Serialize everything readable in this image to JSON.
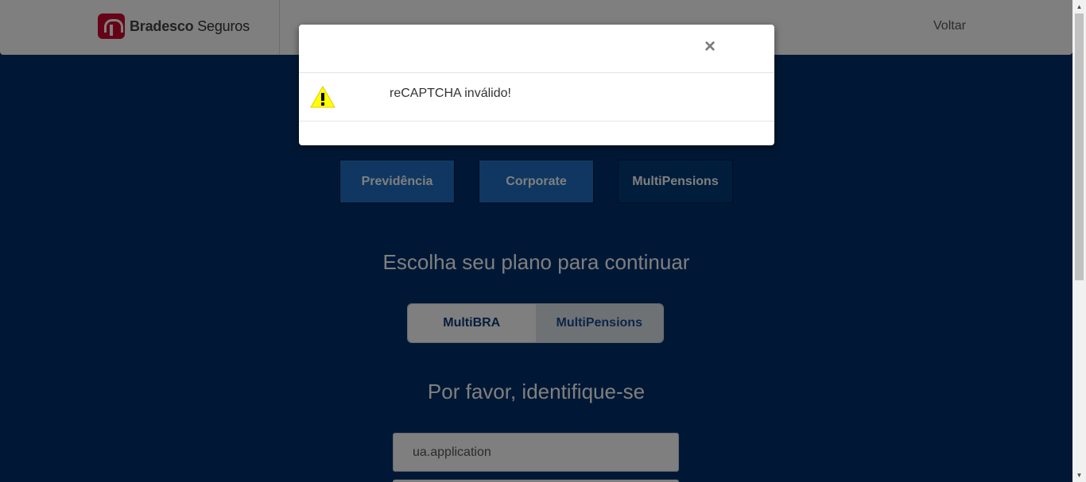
{
  "header": {
    "brand_bold": "Bradesco",
    "brand_regular": "Seguros",
    "back_label": "Voltar"
  },
  "categories": {
    "previdencia": "Previdência",
    "corporate": "Corporate",
    "multipensions": "MultiPensions"
  },
  "plan": {
    "heading": "Escolha seu plano para continuar",
    "options": [
      "MultiBRA",
      "MultiPensions"
    ],
    "selected": "MultiPensions"
  },
  "login": {
    "heading": "Por favor, identifique-se",
    "username_value": "ua.application"
  },
  "modal": {
    "close_glyph": "×",
    "message": "reCAPTCHA inválido!"
  },
  "colors": {
    "background": "#00306a",
    "accent_button": "#1f6ec2",
    "brand_red": "#cc092f",
    "warning_yellow": "#ffff00"
  }
}
